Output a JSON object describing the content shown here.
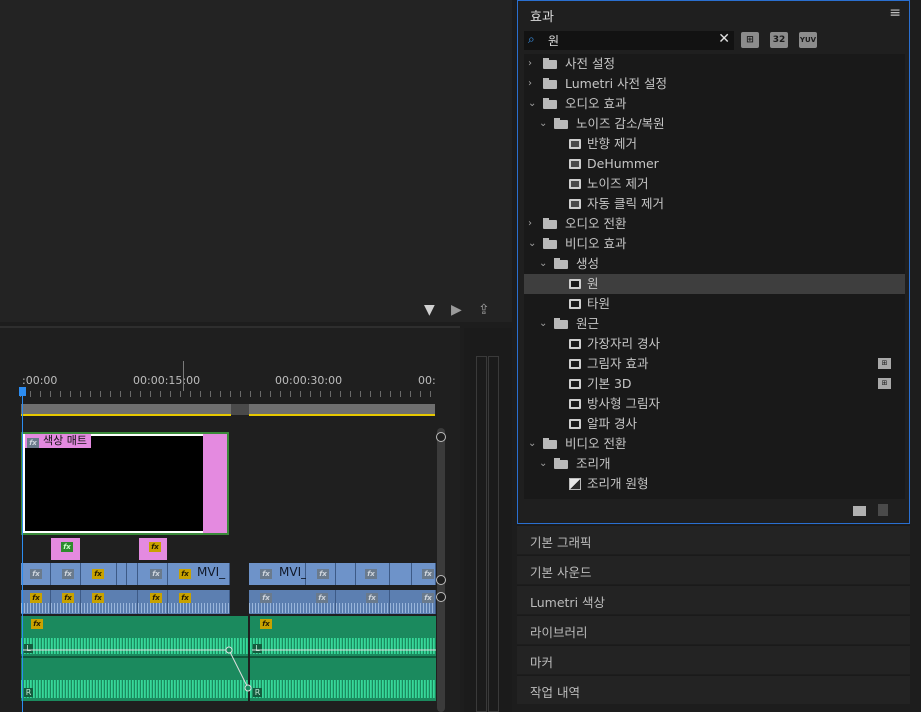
{
  "effects_panel": {
    "title": "효과",
    "menu_glyph": "≡",
    "search": {
      "value": "원",
      "clear_glyph": "✕"
    },
    "bin_icons": [
      "⊞",
      "32",
      "YUV"
    ],
    "tree": [
      {
        "label": "사전 설정",
        "level": 0,
        "kind": "folder-star",
        "expanded": false
      },
      {
        "label": "Lumetri 사전 설정",
        "level": 0,
        "kind": "folder-star",
        "expanded": false
      },
      {
        "label": "오디오 효과",
        "level": 0,
        "kind": "folder",
        "expanded": true
      },
      {
        "label": "노이즈 감소/복원",
        "level": 1,
        "kind": "folder",
        "expanded": true
      },
      {
        "label": "반향 제거",
        "level": 2,
        "kind": "audio-effect"
      },
      {
        "label": "DeHummer",
        "level": 2,
        "kind": "audio-effect"
      },
      {
        "label": "노이즈 제거",
        "level": 2,
        "kind": "audio-effect"
      },
      {
        "label": "자동 클릭 제거",
        "level": 2,
        "kind": "audio-effect"
      },
      {
        "label": "오디오 전환",
        "level": 0,
        "kind": "folder",
        "expanded": false
      },
      {
        "label": "비디오 효과",
        "level": 0,
        "kind": "folder",
        "expanded": true
      },
      {
        "label": "생성",
        "level": 1,
        "kind": "folder",
        "expanded": true
      },
      {
        "label": "원",
        "level": 2,
        "kind": "video-effect",
        "selected": true
      },
      {
        "label": "타원",
        "level": 2,
        "kind": "video-effect"
      },
      {
        "label": "원근",
        "level": 1,
        "kind": "folder",
        "expanded": true
      },
      {
        "label": "가장자리 경사",
        "level": 2,
        "kind": "video-effect"
      },
      {
        "label": "그림자 효과",
        "level": 2,
        "kind": "video-effect",
        "badge": true
      },
      {
        "label": "기본 3D",
        "level": 2,
        "kind": "video-effect",
        "badge": true
      },
      {
        "label": "방사형 그림자",
        "level": 2,
        "kind": "video-effect"
      },
      {
        "label": "알파 경사",
        "level": 2,
        "kind": "video-effect"
      },
      {
        "label": "비디오 전환",
        "level": 0,
        "kind": "folder",
        "expanded": true
      },
      {
        "label": "조리개",
        "level": 1,
        "kind": "folder",
        "expanded": true
      },
      {
        "label": "조리개 원형",
        "level": 2,
        "kind": "transition"
      }
    ]
  },
  "collapsed_panels": [
    "기본 그래픽",
    "기본 사운드",
    "Lumetri 색상",
    "라이브러리",
    "마커",
    "작업 내역"
  ],
  "timeline": {
    "timecodes": [
      ":00:00",
      "00:00:15:00",
      "00:00:30:00",
      "00:"
    ],
    "v2_clip_label": "색상 매트",
    "v1_clip_label_1": "MVI_",
    "v1_clip_label_2": "MVI_",
    "fx_glyph": "fx",
    "channel_left": "L",
    "channel_right": "R"
  },
  "toolbar_icons": [
    "filter-icon",
    "insert-icon",
    "export-frame-icon"
  ],
  "colors": {
    "accent_blue": "#2c8cf0",
    "matte_pink": "#e48ae0",
    "video_clip": "#6e93c9",
    "audio_clip": "#1b8a5e",
    "selection_border": "#2a6fd0"
  }
}
